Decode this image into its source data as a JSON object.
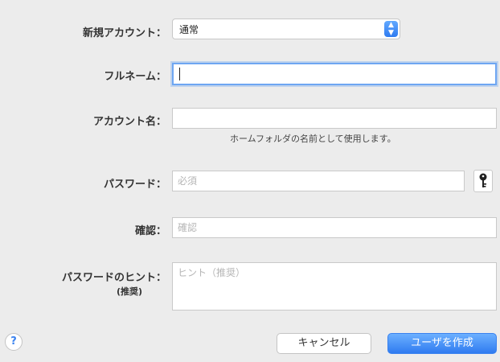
{
  "form": {
    "account_type": {
      "label": "新規アカウント：",
      "value": "通常"
    },
    "full_name": {
      "label": "フルネーム：",
      "value": ""
    },
    "account_name": {
      "label": "アカウント名：",
      "value": "",
      "helper": "ホームフォルダの名前として使用します。"
    },
    "password": {
      "label": "パスワード：",
      "placeholder": "必須"
    },
    "verify": {
      "label": "確認：",
      "placeholder": "確認"
    },
    "hint": {
      "label": "パスワードのヒント：",
      "sublabel": "(推奨)",
      "placeholder": "ヒント（推奨）"
    }
  },
  "buttons": {
    "help": "?",
    "cancel": "キャンセル",
    "create": "ユーザを作成"
  },
  "icons": {
    "password_assistant": "key-icon",
    "popup_stepper": "up-down-chevron-icon"
  },
  "colors": {
    "accent": "#2f7bf0",
    "focus_ring": "#6ea6f2",
    "background": "#ececec"
  }
}
